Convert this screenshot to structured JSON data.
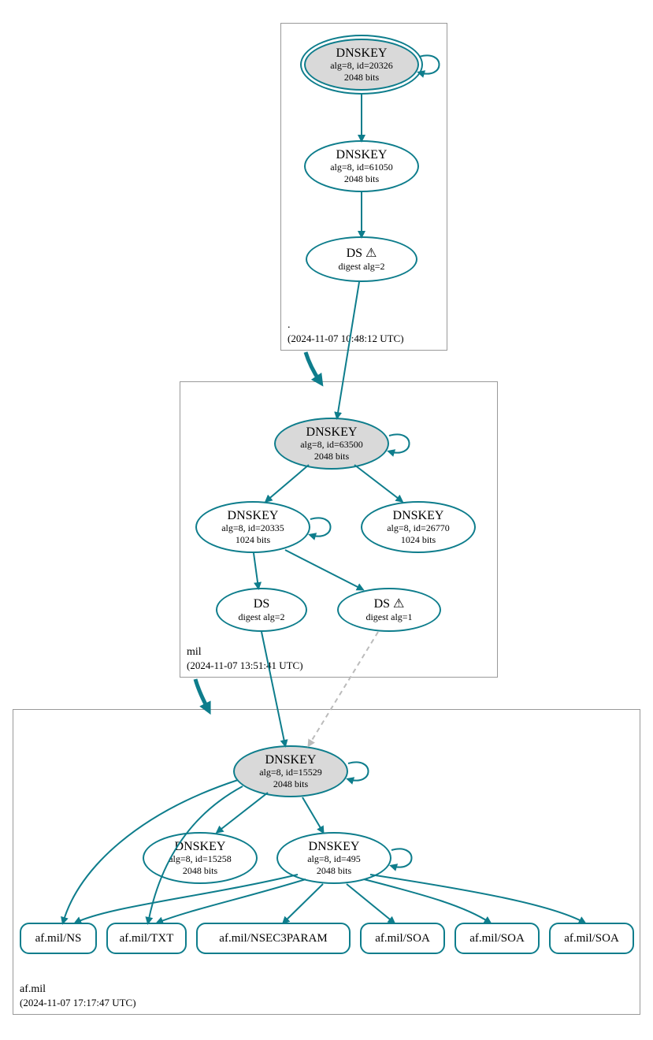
{
  "colors": {
    "teal": "#0e7d8c",
    "nodeFillTrust": "#d9d9d9",
    "gray": "#bbbbbb"
  },
  "zones": {
    "root": {
      "label": ".",
      "timestamp": "(2024-11-07 10:48:12 UTC)"
    },
    "mil": {
      "label": "mil",
      "timestamp": "(2024-11-07 13:51:41 UTC)"
    },
    "af": {
      "label": "af.mil",
      "timestamp": "(2024-11-07 17:17:47 UTC)"
    }
  },
  "nodes": {
    "root_ksk": {
      "title": "DNSKEY",
      "alg": "alg=8, id=20326",
      "bits": "2048 bits"
    },
    "root_zsk": {
      "title": "DNSKEY",
      "alg": "alg=8, id=61050",
      "bits": "2048 bits"
    },
    "root_ds": {
      "title": "DS",
      "digest": "digest alg=2",
      "warn": "⚠"
    },
    "mil_ksk": {
      "title": "DNSKEY",
      "alg": "alg=8, id=63500",
      "bits": "2048 bits"
    },
    "mil_zsk": {
      "title": "DNSKEY",
      "alg": "alg=8, id=20335",
      "bits": "1024 bits"
    },
    "mil_zsk2": {
      "title": "DNSKEY",
      "alg": "alg=8, id=26770",
      "bits": "1024 bits"
    },
    "mil_ds2": {
      "title": "DS",
      "digest": "digest alg=2"
    },
    "mil_ds1": {
      "title": "DS",
      "digest": "digest alg=1",
      "warn": "⚠"
    },
    "af_ksk": {
      "title": "DNSKEY",
      "alg": "alg=8, id=15529",
      "bits": "2048 bits"
    },
    "af_zsk2": {
      "title": "DNSKEY",
      "alg": "alg=8, id=15258",
      "bits": "2048 bits"
    },
    "af_zsk": {
      "title": "DNSKEY",
      "alg": "alg=8, id=495",
      "bits": "2048 bits"
    }
  },
  "leaves": {
    "l0": "af.mil/NS",
    "l1": "af.mil/TXT",
    "l2": "af.mil/NSEC3PARAM",
    "l3": "af.mil/SOA",
    "l4": "af.mil/SOA",
    "l5": "af.mil/SOA"
  }
}
